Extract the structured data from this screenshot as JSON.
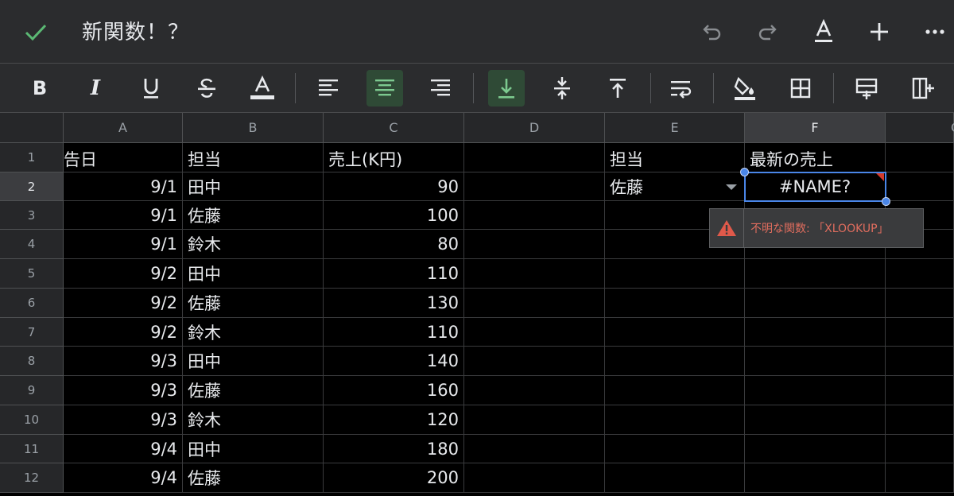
{
  "app": {
    "title": "新関数！？"
  },
  "colors": {
    "accent": "#4a86e8",
    "active_bg": "#2f4a36",
    "error": "#d33a2c",
    "check": "#5bb974"
  },
  "toolbar_icons": [
    "bold-icon",
    "italic-icon",
    "underline-icon",
    "strikethrough-icon",
    "text-color-icon",
    "align-left-icon",
    "align-center-icon",
    "align-right-icon",
    "valign-bottom-icon",
    "valign-middle-icon",
    "valign-top-icon",
    "wrap-text-icon",
    "fill-color-icon",
    "borders-icon",
    "insert-row-icon",
    "insert-column-icon"
  ],
  "toolbar": {
    "bold": "B",
    "italic": "I"
  },
  "columns": [
    "A",
    "B",
    "C",
    "D",
    "E",
    "F"
  ],
  "partial_column": "G",
  "row_numbers": [
    "1",
    "2",
    "3",
    "4",
    "5",
    "6",
    "7",
    "8",
    "9",
    "10",
    "11",
    "12"
  ],
  "cells": {
    "A1": "告日",
    "B1": "担当",
    "C1": "売上(K円)",
    "E1": "担当",
    "F1": "最新の売上",
    "A2": "9/1",
    "B2": "田中",
    "C2": "90",
    "E2": "佐藤",
    "F2": "#NAME?",
    "A3": "9/1",
    "B3": "佐藤",
    "C3": "100",
    "A4": "9/1",
    "B4": "鈴木",
    "C4": "80",
    "A5": "9/2",
    "B5": "田中",
    "C5": "110",
    "A6": "9/2",
    "B6": "佐藤",
    "C6": "130",
    "A7": "9/2",
    "B7": "鈴木",
    "C7": "110",
    "A8": "9/3",
    "B8": "田中",
    "C8": "140",
    "A9": "9/3",
    "B9": "佐藤",
    "C9": "160",
    "A10": "9/3",
    "B10": "鈴木",
    "C10": "120",
    "A11": "9/4",
    "B11": "田中",
    "C11": "180",
    "A12": "9/4",
    "B12": "佐藤",
    "C12": "200"
  },
  "selected_cell": "F2",
  "error_tooltip": {
    "message": "不明な関数: 「XLOOKUP」"
  }
}
